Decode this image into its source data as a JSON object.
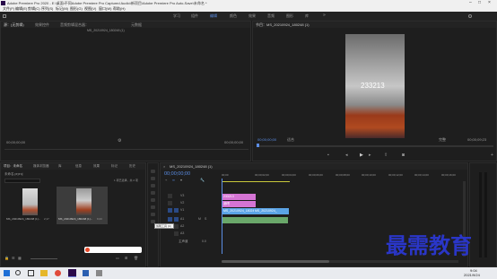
{
  "window": {
    "title": "Adobe Premiere Pro 2020 - E:\\桌面\\不同Adobe Premiere Pro Captured Audio\\新项目\\Adobe Premiere Pro Auto-Save\\未命名 *"
  },
  "menu": [
    "文件(F)",
    "编辑(E)",
    "剪辑(C)",
    "序列(S)",
    "标记(M)",
    "图形(G)",
    "视图(V)",
    "窗口(W)",
    "帮助(H)"
  ],
  "workspaces": [
    "学习",
    "组件",
    "编辑",
    "颜色",
    "效果",
    "音频",
    "图形",
    "库"
  ],
  "source_panel": {
    "tabs": [
      "源：(无剪辑)",
      "效果控件",
      "音频剪辑混合器：",
      "元数据"
    ],
    "clip_label": "MS_20210924_180248 (1)",
    "timecode_left": "00;00;00;00",
    "timecode_right": "00;00;00;00"
  },
  "program_panel": {
    "title": "节目：MS_20210924_180248 (1)",
    "overlay_text": "233213",
    "timecode": "00;00;00;00",
    "fit": "适合",
    "quality": "完整",
    "duration": "00;00;09;23"
  },
  "project_panel": {
    "tabs": [
      "项目：未命名",
      "媒体浏览器",
      "库",
      "信息",
      "效果",
      "标记",
      "历史"
    ],
    "file": "未命名.prproj",
    "count": "1 项已选择，共 2 项",
    "items": [
      {
        "name": "MS_20210924_180248 (1)...",
        "dur": "2;17"
      },
      {
        "name": "MS_20210924_180248 (1)...",
        "dur": "9;23"
      }
    ]
  },
  "timeline": {
    "title": "MS_20210924_180248 (1)",
    "timecode": "00;00;00;00",
    "ruler": [
      "00;00",
      "00;00;02;00",
      "00;00;04;00",
      "00;00;06;00",
      "00;00;08;00",
      "00;00;10;00",
      "00;00;12;00",
      "00;00;14;00",
      "00;00;16;00",
      "00;00;18;00"
    ],
    "tracks": [
      "V3",
      "V2",
      "V1",
      "A1",
      "A2",
      "A3"
    ],
    "master": "主声道",
    "master_val": "0.0",
    "clips": {
      "v3": "233213",
      "v2": "酒吧",
      "v1": "MS_20210924_180248.mp4",
      "v1b": "MS_20210924_"
    },
    "tooltip": "剪辑工具 (C)"
  },
  "watermark": "最需教育",
  "taskbar": {
    "time": "9:04",
    "date": "2021/9/24"
  }
}
